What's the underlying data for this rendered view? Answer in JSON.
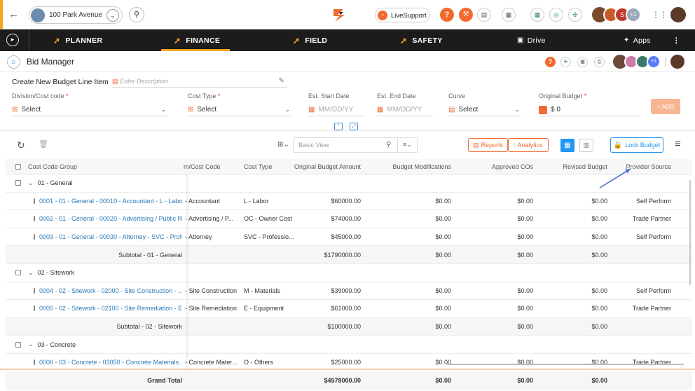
{
  "topbar": {
    "project_name": "100 Park Avenue",
    "live_support": "LiveSupport",
    "avatar_more_count": "+1"
  },
  "nav": {
    "tabs": [
      "PLANNER",
      "FINANCE",
      "FIELD",
      "SAFETY"
    ],
    "drive": "Drive",
    "apps": "Apps",
    "active": "FINANCE"
  },
  "page": {
    "title": "Bid Manager",
    "avatar_more_count": "+1"
  },
  "form": {
    "heading": "Create New Budget Line Item",
    "description_placeholder": "Enter Description",
    "division_label": "Division/Cost code",
    "division_value": "Select",
    "cost_type_label": "Cost Type",
    "cost_type_value": "Select",
    "start_label": "Est. Start Date",
    "start_placeholder": "MM/DD/YY",
    "end_label": "Est. End Date",
    "end_placeholder": "MM/DD/YY",
    "curve_label": "Curve",
    "curve_value": "Select",
    "budget_label": "Original Budget",
    "budget_value": "$ 0",
    "add_button": "+ ADD"
  },
  "toolbar": {
    "view_placeholder": "Basic View",
    "reports": "Reports",
    "analytics": "Analytics",
    "lock_budget": "Lock Budget"
  },
  "table": {
    "columns": [
      "Cost Code Group",
      "m/Cost Code",
      "Cost Type",
      "Original Budget Amount",
      "Budget Modifications",
      "Approved COs",
      "Revised Budget",
      "Provider Source"
    ],
    "groups": [
      {
        "name": "01 - General",
        "rows": [
          {
            "code": "0001 - 01 - General - 00010 - Accountant - L - Labor",
            "costcode": "- Accountant",
            "type": "L - Labor",
            "orig": "$60000.00",
            "mods": "$0.00",
            "cos": "$0.00",
            "revised": "$0.00",
            "provider": "Self Perform"
          },
          {
            "code": "0002 - 01 - General - 00020 - Advertising / Public R...",
            "costcode": "- Advertising / P...",
            "type": "OC - Owner Cost",
            "orig": "$74000.00",
            "mods": "$0.00",
            "cos": "$0.00",
            "revised": "$0.00",
            "provider": "Trade Partner"
          },
          {
            "code": "0003 - 01 - General - 00030 - Attorney - SVC - Profe...",
            "costcode": "- Attorney",
            "type": "SVC - Professio...",
            "orig": "$45000.00",
            "mods": "$0.00",
            "cos": "$0.00",
            "revised": "$0.00",
            "provider": "Self Perform"
          }
        ],
        "subtotal_label": "Subtotal - 01 - General",
        "subtotal": {
          "orig": "$1790000.00",
          "mods": "$0.00",
          "cos": "$0.00",
          "revised": "$0.00"
        }
      },
      {
        "name": "02 - Sitework",
        "rows": [
          {
            "code": "0004 - 02 - Sitework - 02000 - Site Construction - ...",
            "costcode": "- Site Construction",
            "type": "M - Materials",
            "orig": "$39000.00",
            "mods": "$0.00",
            "cos": "$0.00",
            "revised": "$0.00",
            "provider": "Self Perform"
          },
          {
            "code": "0005 - 02 - Sitework - 02100 - Site Remediation - E...",
            "costcode": "- Site Remediation",
            "type": "E - Equipment",
            "orig": "$61000.00",
            "mods": "$0.00",
            "cos": "$0.00",
            "revised": "$0.00",
            "provider": "Trade Partner"
          }
        ],
        "subtotal_label": "Subtotal - 02 - Sitework",
        "subtotal": {
          "orig": "$100000.00",
          "mods": "$0.00",
          "cos": "$0.00",
          "revised": "$0.00"
        }
      },
      {
        "name": "03 - Concrete",
        "rows": [
          {
            "code": "0006 - 03 - Concrete - 03050 - Concrete Materials ...",
            "costcode": "- Concrete Mater...",
            "type": "O - Others",
            "orig": "$25000.00",
            "mods": "$0.00",
            "cos": "$0.00",
            "revised": "$0.00",
            "provider": "Trade Partner"
          }
        ]
      }
    ],
    "grand_total_label": "Grand Total",
    "grand_total": {
      "orig": "$4578000.00",
      "mods": "$0.00",
      "cos": "$0.00",
      "revised": "$0.00"
    }
  },
  "colors": {
    "accent": "#f26a2e",
    "brand_yellow": "#f5a623",
    "link": "#2a7ab8",
    "nav_bg": "#1c1c1c",
    "primary_blue": "#2196f3"
  }
}
